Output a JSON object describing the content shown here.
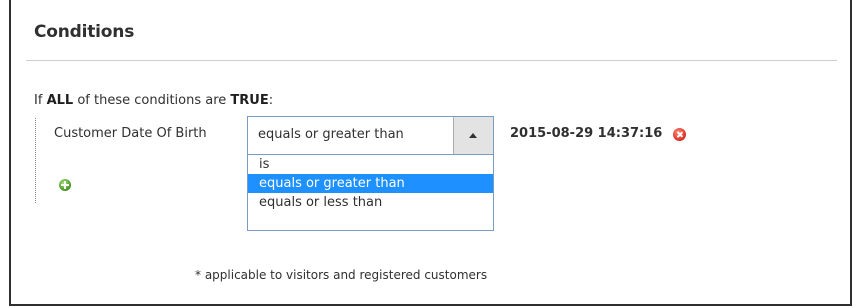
{
  "section": {
    "title": "Conditions"
  },
  "intro": {
    "prefix": "If",
    "aggregator": "ALL",
    "middle": "of these conditions are",
    "value": "TRUE",
    "suffix": ":"
  },
  "condition": {
    "attribute_label": "Customer Date Of Birth",
    "operator_selected": "equals or greater than",
    "operator_options": [
      "is",
      "equals or greater than",
      "equals or less than"
    ],
    "operator_highlighted_index": 1,
    "value": "2015-08-29 14:37:16",
    "remove_icon": "remove-icon"
  },
  "add_condition_icon": "add-icon",
  "footnote": "* applicable to visitors and registered customers",
  "colors": {
    "highlight": "#1e90ff",
    "select_border": "#7a9cc2",
    "remove_icon": "#e0392b",
    "add_icon": "#4c9a2a"
  }
}
